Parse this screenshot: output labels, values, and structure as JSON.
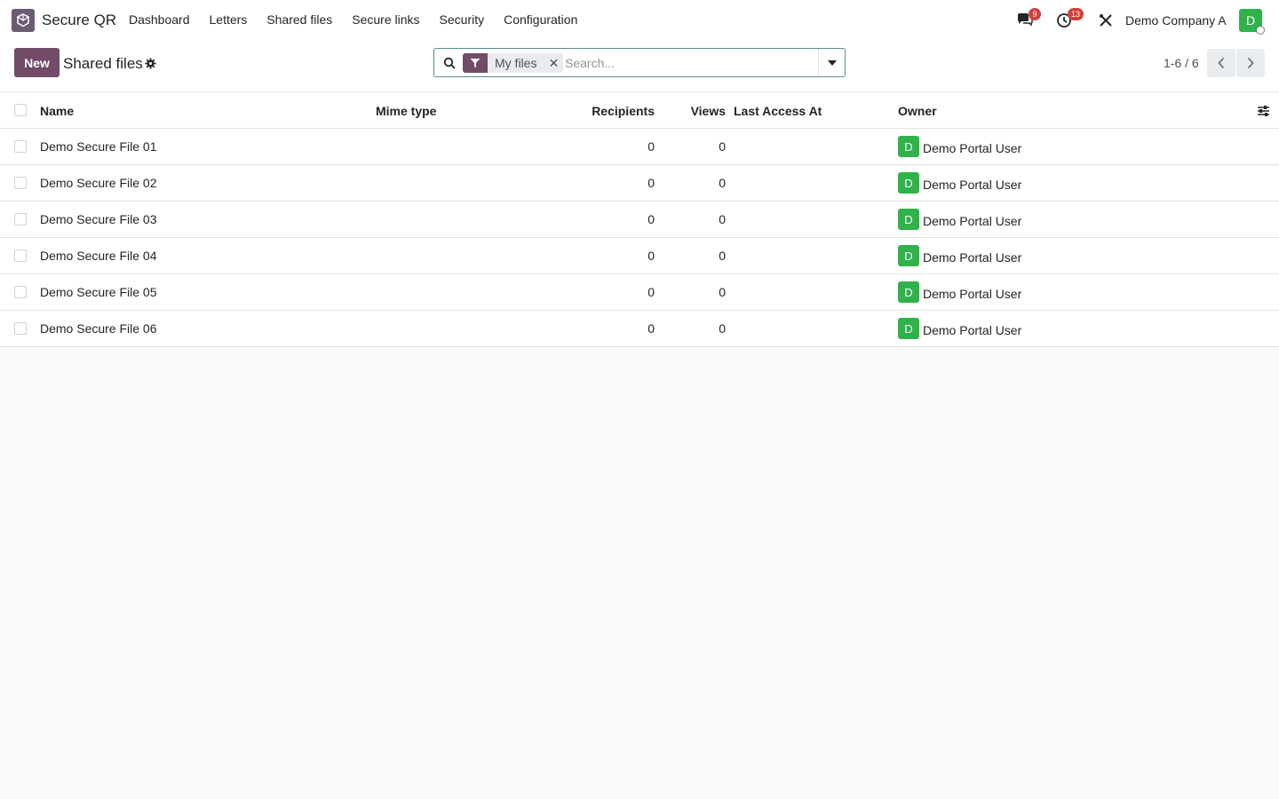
{
  "navbar": {
    "app_name": "Secure QR",
    "menu": [
      "Dashboard",
      "Letters",
      "Shared files",
      "Secure links",
      "Security",
      "Configuration"
    ],
    "messages_badge": "9",
    "activities_badge": "13",
    "company": "Demo Company A",
    "user_initial": "D"
  },
  "control": {
    "new_label": "New",
    "title": "Shared files",
    "facet_label": "My files",
    "search_placeholder": "Search...",
    "pager_value": "1-6 / 6"
  },
  "table": {
    "headers": {
      "name": "Name",
      "mime": "Mime type",
      "recipients": "Recipients",
      "views": "Views",
      "last_access": "Last Access At",
      "owner": "Owner"
    },
    "rows": [
      {
        "name": "Demo Secure File 01",
        "mime": "",
        "recipients": "0",
        "views": "0",
        "last_access": "",
        "owner_initial": "D",
        "owner": "Demo Portal User"
      },
      {
        "name": "Demo Secure File 02",
        "mime": "",
        "recipients": "0",
        "views": "0",
        "last_access": "",
        "owner_initial": "D",
        "owner": "Demo Portal User"
      },
      {
        "name": "Demo Secure File 03",
        "mime": "",
        "recipients": "0",
        "views": "0",
        "last_access": "",
        "owner_initial": "D",
        "owner": "Demo Portal User"
      },
      {
        "name": "Demo Secure File 04",
        "mime": "",
        "recipients": "0",
        "views": "0",
        "last_access": "",
        "owner_initial": "D",
        "owner": "Demo Portal User"
      },
      {
        "name": "Demo Secure File 05",
        "mime": "",
        "recipients": "0",
        "views": "0",
        "last_access": "",
        "owner_initial": "D",
        "owner": "Demo Portal User"
      },
      {
        "name": "Demo Secure File 06",
        "mime": "",
        "recipients": "0",
        "views": "0",
        "last_access": "",
        "owner_initial": "D",
        "owner": "Demo Portal User"
      }
    ]
  },
  "colors": {
    "brand": "#714b67",
    "avatar": "#2fb24a",
    "badge": "#d23f3a"
  },
  "icons": [
    "app-logo-icon",
    "messages-icon",
    "activities-icon",
    "debug-tools-icon",
    "gear-icon",
    "search-icon",
    "filter-icon",
    "close-icon",
    "caret-down-icon",
    "chevron-left-icon",
    "chevron-right-icon",
    "column-settings-icon"
  ]
}
